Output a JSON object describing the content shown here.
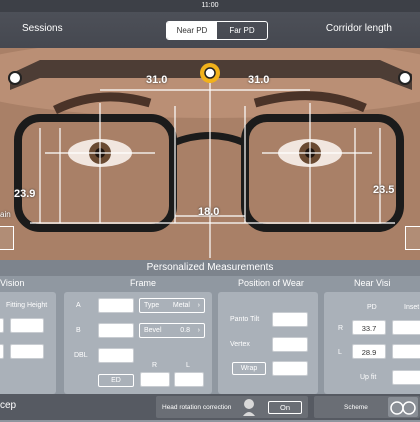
{
  "status_bar": {
    "time": "11:00"
  },
  "nav": {
    "left": "Sessions",
    "right": "Corridor length",
    "segments": [
      {
        "label": "Near PD",
        "active": true
      },
      {
        "label": "Far PD",
        "active": false
      }
    ]
  },
  "photo": {
    "measurements": {
      "left_pd": "31.0",
      "right_pd": "31.0",
      "left_height": "23.9",
      "right_height": "23.5",
      "bridge": "18.0"
    },
    "left_edge_text": "ain"
  },
  "panel": {
    "title": "Personalized Measurements",
    "sections": {
      "vision": "Vision",
      "frame": "Frame",
      "position": "Position of Wear",
      "near": "Near Visi"
    },
    "vision": {
      "fitting_height_label": "Fitting Height"
    },
    "frame": {
      "a_label": "A",
      "b_label": "B",
      "dbl_label": "DBL",
      "type_label": "Type",
      "type_value": "Metal",
      "bevel_label": "Bevel",
      "bevel_value": "0.8",
      "ed_label": "ED",
      "r_label": "R",
      "l_label": "L"
    },
    "position": {
      "panto_label": "Panto Tilt",
      "vertex_label": "Vertex",
      "wrap_label": "Wrap"
    },
    "near": {
      "pd_label": "PD",
      "inset_label": "Inset",
      "r_label": "R",
      "r_pd": "33.7",
      "l_label": "L",
      "l_pd": "28.9",
      "upfit_label": "Up fit"
    }
  },
  "bottom": {
    "brand": "cep",
    "head_rotation_label": "Head rotation correction",
    "head_rotation_value": "On",
    "scheme_label": "Scheme"
  },
  "colors": {
    "guide_line": "#ffffff",
    "frame_marker": "#f2b21b"
  }
}
